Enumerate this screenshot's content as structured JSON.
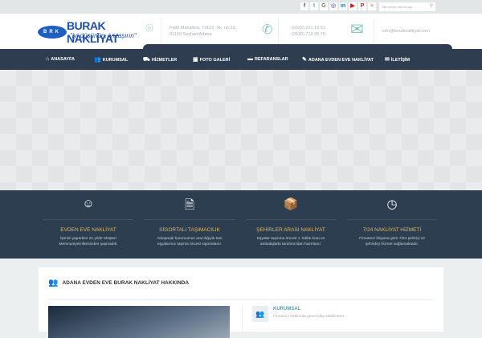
{
  "topbar": {
    "social": [
      {
        "name": "facebook",
        "g": "f",
        "c": "#3b5998"
      },
      {
        "name": "twitter",
        "g": "t",
        "c": "#55acee"
      },
      {
        "name": "google-plus",
        "g": "G",
        "c": "#777"
      },
      {
        "name": "instagram",
        "g": "◎",
        "c": "#8a6fb0"
      },
      {
        "name": "linkedin",
        "g": "in",
        "c": "#0e76a8"
      },
      {
        "name": "youtube",
        "g": "▶",
        "c": "#cc181e"
      },
      {
        "name": "pinterest",
        "g": "P",
        "c": "#cb2027"
      },
      {
        "name": "rss",
        "g": "≈",
        "c": "#f26522"
      }
    ],
    "search_placeholder": "Site içinde arama yap"
  },
  "logo": {
    "badge": "BRK",
    "name": "BURAK NAKLİYAT",
    "slogan": "\"iyi düşünün, iyi taşırın\""
  },
  "contact": {
    "address1": "Fatih Mahallesi, 73102. Sk. no:23,",
    "address2": "01160 Seyhan/Adana",
    "phone1": "(0322) 231 19 51",
    "phone2": "(0530) 719 95 76",
    "email": "info@buraknakliyat.com"
  },
  "nav": [
    {
      "icon": "home",
      "label": "ANASAYFA"
    },
    {
      "icon": "users",
      "label": "KURUMSAL"
    },
    {
      "icon": "truck",
      "label": "HİZMETLER"
    },
    {
      "icon": "image",
      "label": "FOTO GALERİ"
    },
    {
      "icon": "briefcase",
      "label": "REFARANSLAR"
    },
    {
      "icon": "pencil",
      "label": "ADANA EVDEN EVE NAKLİYAT"
    },
    {
      "icon": "envelope",
      "label": "İLETİŞİM"
    }
  ],
  "features": [
    {
      "icon": "smile",
      "title": "EVDEN EVE NAKLİYAT",
      "desc1": "İşimizi yaparken 21 yıldır Müşteri",
      "desc2": "Memnuniyeti ilkesinden şaşmadık."
    },
    {
      "icon": "document",
      "title": "SİGORTALI TAŞIMACILIK",
      "desc1": "Anlaşmalı kurumumuz aracılığıyla tüm",
      "desc2": "eşyalarınız taşıma öncesi sigortalanır."
    },
    {
      "icon": "box",
      "title": "ŞEHİRLER ARASI NAKLİYAT",
      "desc1": "Eşyalar taşınma öncesi 1. kalite kutu ve",
      "desc2": "ambalajlarla tarafımızdan hazırlanır."
    },
    {
      "icon": "clock",
      "title": "7/24 NAKLİYAT HİZMETİ",
      "desc1": "Firmamız ihtiyaca göre 7/24 şehiriçi ve",
      "desc2": "şehirdışı hizmet sağlamaktadır."
    }
  ],
  "about": {
    "title": "ADANA EVDEN EVE BURAK NAKLİYAT HAKKINDA",
    "side_title": "KURUMSAL",
    "side_desc": "Firmamız hakkında genel bilgi alabilirsiniz."
  }
}
